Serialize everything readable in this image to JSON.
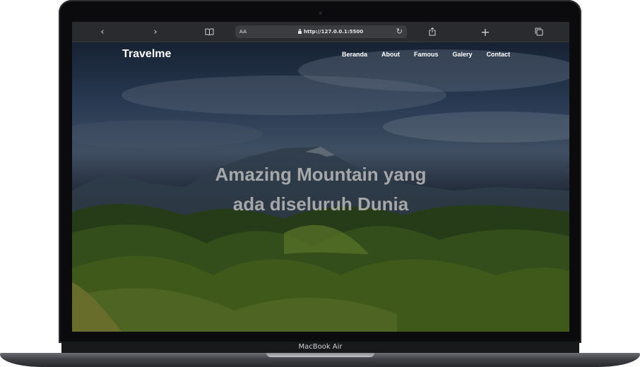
{
  "device": {
    "label": "MacBook Air"
  },
  "browser": {
    "aa_label": "AA",
    "url": "http://127.0.0.1:5500",
    "icons": [
      "back-icon",
      "forward-icon",
      "bookmarks-icon",
      "reload-icon",
      "share-icon",
      "new-tab-icon",
      "tabs-icon"
    ]
  },
  "site": {
    "brand": "Travelme",
    "nav": [
      "Beranda",
      "About",
      "Famous",
      "Galery",
      "Contact"
    ],
    "headline_line1": "Amazing Mountain yang",
    "headline_line2": "ada diseluruh Dunia"
  }
}
